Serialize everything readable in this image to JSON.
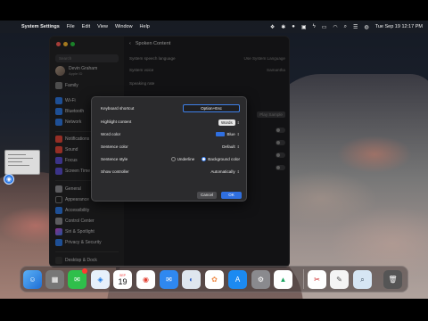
{
  "menubar": {
    "app_name": "System Settings",
    "items": [
      "File",
      "Edit",
      "View",
      "Window",
      "Help"
    ],
    "clock": "Tue Sep 19  12:17 PM"
  },
  "window": {
    "search_placeholder": "Search",
    "user_name": "Devin Graham",
    "user_sub": "Apple ID",
    "family": "Family",
    "header_title": "Spoken Content",
    "sidebar_items": [
      "Wi-Fi",
      "Bluetooth",
      "Network",
      "Notifications",
      "Sound",
      "Focus",
      "Screen Time",
      "General",
      "Appearance",
      "Accessibility",
      "Control Center",
      "Siri & Spotlight",
      "Privacy & Security",
      "Desktop & Dock"
    ],
    "main_rows": [
      {
        "label": "System speech language",
        "value": "Use System Language"
      },
      {
        "label": "System voice",
        "value": "Samantha"
      },
      {
        "label": "Speaking rate",
        "value": ""
      }
    ],
    "play_sample_label": "Play Sample"
  },
  "sheet": {
    "keyboard_shortcut_label": "Keyboard shortcut",
    "keyboard_shortcut_value": "Option+Esc",
    "highlight_content_label": "Highlight content",
    "highlight_content_value": "Words",
    "word_color_label": "Word color",
    "word_color_value": "Blue",
    "sentence_color_label": "Sentence color",
    "sentence_color_value": "Default",
    "sentence_style_label": "Sentence style",
    "sentence_style_options": [
      "Underline",
      "Background color"
    ],
    "sentence_style_selected": "Background color",
    "show_controller_label": "Show controller",
    "show_controller_value": "Automatically",
    "cancel_label": "Cancel",
    "ok_label": "OK"
  },
  "dock": {
    "calendar_day": "19",
    "calendar_month": "SEP"
  },
  "colors": {
    "accent": "#2f6fe0",
    "window_bg": "#1d1d1f",
    "sheet_bg": "#2b2b2d"
  }
}
